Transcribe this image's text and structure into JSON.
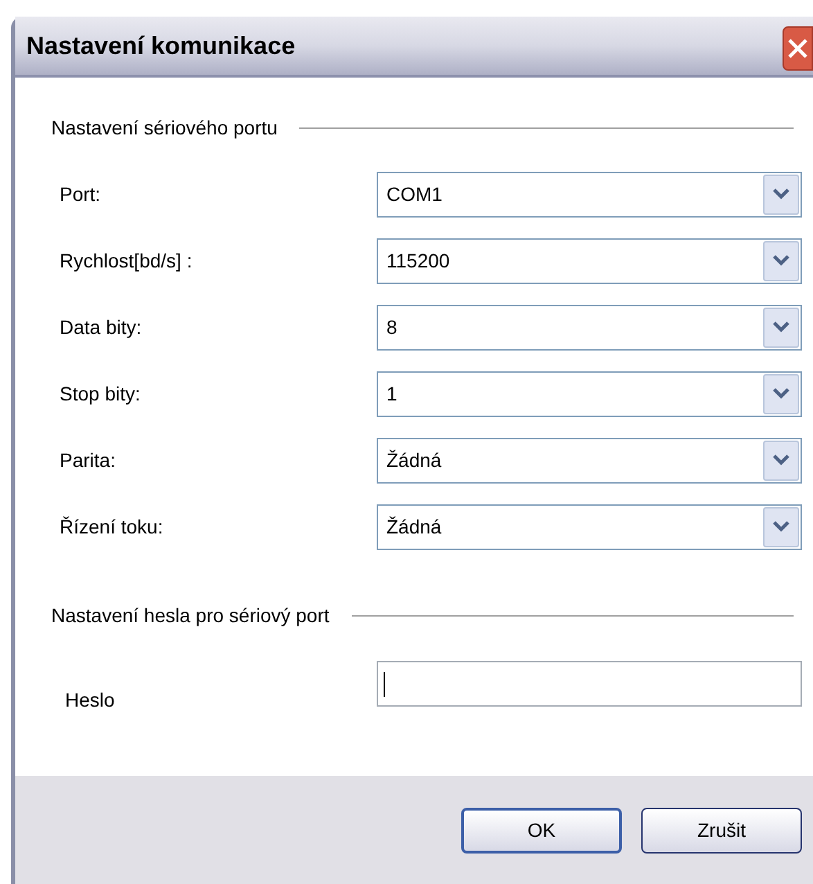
{
  "window": {
    "title": "Nastavení komunikace"
  },
  "sections": [
    {
      "title": "Nastavení sériového portu",
      "rows": [
        {
          "kind": "dropdown",
          "label": "Port:",
          "value": "COM1"
        },
        {
          "kind": "dropdown",
          "label": "Rychlost[bd/s] :",
          "value": "115200"
        },
        {
          "kind": "dropdown",
          "label": "Data bity:",
          "value": "8"
        },
        {
          "kind": "dropdown",
          "label": "Stop bity:",
          "value": "1"
        },
        {
          "kind": "dropdown",
          "label": "Parita:",
          "value": "Žádná"
        },
        {
          "kind": "dropdown",
          "label": "Řízení toku:",
          "value": "Žádná"
        }
      ]
    },
    {
      "title": "Nastavení hesla pro sériový port",
      "rows": [
        {
          "kind": "password",
          "label": "Heslo",
          "focused": true
        }
      ]
    }
  ],
  "buttons": [
    {
      "label": "OK",
      "default": true
    },
    {
      "label": "Zrušit",
      "default": false
    }
  ]
}
